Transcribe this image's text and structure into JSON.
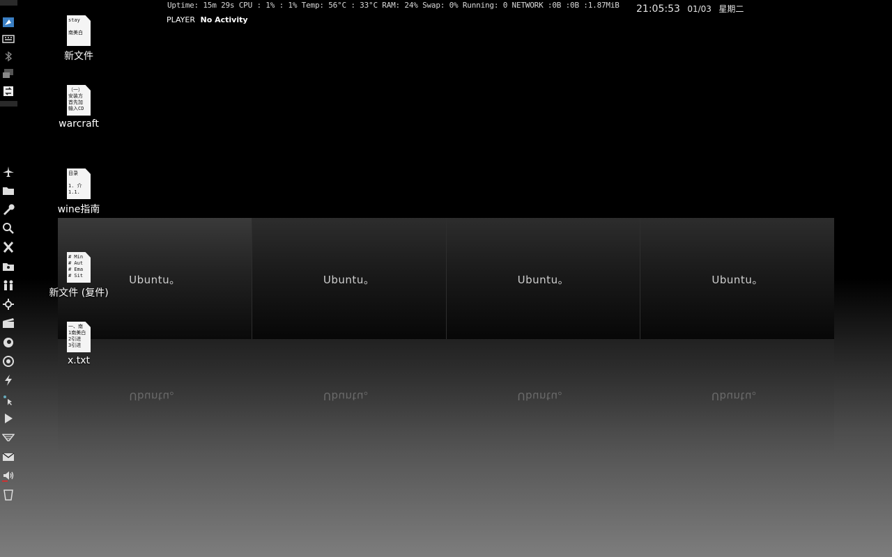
{
  "status": {
    "line": "Uptime: 15m 29s  CPU : 1% : 1%  Temp: 56°C : 33°C  RAM: 24%  Swap: 0%  Running: 0  NETWORK :0B  :0B  :1.87MiB",
    "time": "21:05:53",
    "date": "01/03",
    "weekday": "星期二"
  },
  "player": {
    "label": "PLAYER",
    "state": "No Activity"
  },
  "desktop_icons": [
    {
      "label": "新文件",
      "preview": [
        "stay",
        "",
        "南美白"
      ]
    },
    {
      "label": "warcraft",
      "preview": [
        "（一）",
        "安装方",
        "首先加",
        "输入CD"
      ]
    },
    {
      "label": "wine指南",
      "preview": [
        "目录",
        "",
        "1. 介",
        "1.1."
      ]
    },
    {
      "label": "新文件 (复件)",
      "preview": [
        "# Min",
        "# Aut",
        "# Ema",
        "# Sit"
      ]
    },
    {
      "label": "x.txt",
      "preview": [
        "一、南",
        "1南美白",
        "2引进",
        "3引进"
      ]
    }
  ],
  "workspaces": [
    {
      "name": "Ubuntu。",
      "active": true
    },
    {
      "name": "Ubuntu。",
      "active": false
    },
    {
      "name": "Ubuntu。",
      "active": false
    },
    {
      "name": "Ubuntu。",
      "active": false
    }
  ],
  "dock": [
    "window-icon",
    "keyboard-icon",
    "bluetooth-icon",
    "display-icon",
    "switch-icon",
    "airplane-icon",
    "folder-icon",
    "wrench-icon",
    "search-icon",
    "x-icon",
    "folder-open-icon",
    "people-icon",
    "settings-icon",
    "clapper-icon",
    "firefox-icon",
    "chrome-icon",
    "bolt-icon",
    "pointer-icon",
    "play-icon",
    "filter-icon",
    "mail-icon",
    "volume-icon",
    "trash-icon"
  ]
}
